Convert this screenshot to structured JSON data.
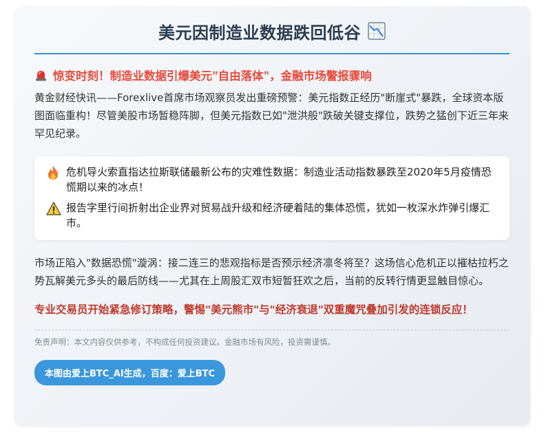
{
  "title": "美元因制造业数据跌回低谷",
  "title_icon": "chart-decreasing-icon",
  "headline": {
    "icon": "police-light-icon",
    "text": "惊变时刻！制造业数据引爆美元\"自由落体\"，金融市场警报骤响"
  },
  "intro": "黄金财经快讯——Forexlive首席市场观察员发出重磅预警：美元指数正经历\"断崖式\"暴跌，全球资本版图面临重构！尽管美股市场暂稳阵脚，但美元指数已如\"泄洪般\"跌破关键支撑位，跌势之猛创下近三年来罕见纪录。",
  "quotes": [
    {
      "icon": "fire-icon",
      "text": "危机导火索直指达拉斯联储最新公布的灾难性数据：制造业活动指数暴跌至2020年5月疫情恐慌期以来的冰点！"
    },
    {
      "icon": "warning-icon",
      "text": "报告字里行间折射出企业界对贸易战升级和经济硬着陆的集体恐慌，犹如一枚深水炸弹引爆汇市。"
    }
  ],
  "body": "市场正陷入\"数据恐慌\"漩涡：接二连三的悲观指标是否预示经济凛冬将至？这场信心危机正以摧枯拉朽之势瓦解美元多头的最后防线——尤其在上周股汇双市短暂狂欢之后，当前的反转行情更显触目惊心。",
  "alert": "专业交易员开始紧急修订策略，警惕\"美元熊市\"与\"经济衰退\"双重魔咒叠加引发的连锁反应！",
  "disclaimer": "免责声明：本文内容仅供参考，不构成任何投资建议。金融市场有风险，投资需谨慎。",
  "badge": "本图由爱上BTC_AI生成，百度：爱上BTC",
  "colors": {
    "accent": "#3b8fd6",
    "headline": "#e74c3c",
    "alert": "#c0392b",
    "title": "#2c3e50",
    "badge_bg": "#3b97dc"
  }
}
